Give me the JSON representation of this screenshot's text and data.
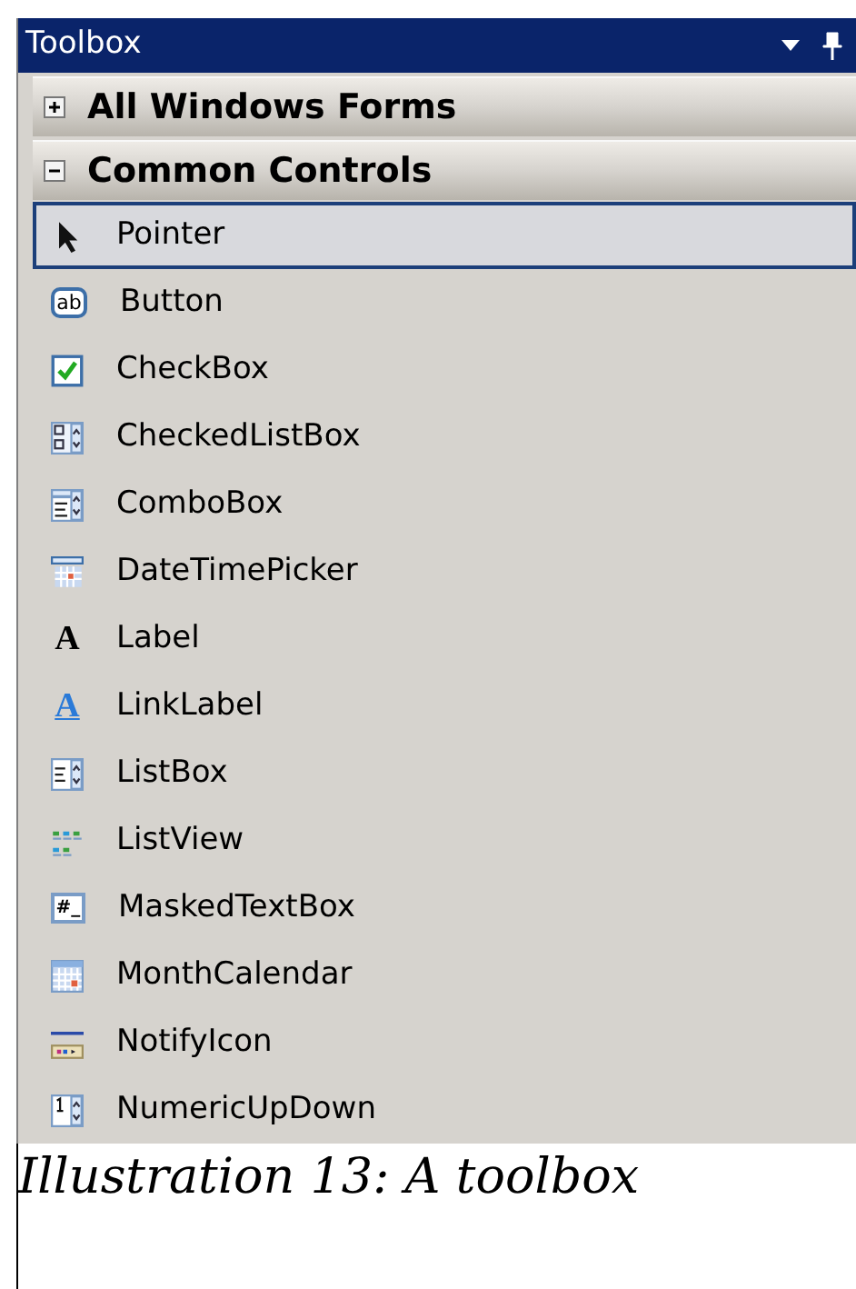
{
  "window": {
    "title": "Toolbox"
  },
  "categories": [
    {
      "label": "All Windows Forms",
      "expanded": false
    },
    {
      "label": "Common Controls",
      "expanded": true
    }
  ],
  "items": [
    {
      "label": "Pointer",
      "kind": "pointer",
      "selected": true
    },
    {
      "label": "Button",
      "kind": "button",
      "icon_text": "ab",
      "selected": false
    },
    {
      "label": "CheckBox",
      "kind": "checkbox",
      "selected": false
    },
    {
      "label": "CheckedListBox",
      "kind": "checkedlistbox",
      "selected": false
    },
    {
      "label": "ComboBox",
      "kind": "combobox",
      "selected": false
    },
    {
      "label": "DateTimePicker",
      "kind": "datetimepicker",
      "selected": false
    },
    {
      "label": "Label",
      "kind": "label",
      "icon_text": "A",
      "selected": false
    },
    {
      "label": "LinkLabel",
      "kind": "linklabel",
      "icon_text": "A",
      "selected": false
    },
    {
      "label": "ListBox",
      "kind": "listbox",
      "selected": false
    },
    {
      "label": "ListView",
      "kind": "listview",
      "selected": false
    },
    {
      "label": "MaskedTextBox",
      "kind": "maskedtextbox",
      "icon_text": "#_",
      "selected": false
    },
    {
      "label": "MonthCalendar",
      "kind": "monthcalendar",
      "selected": false
    },
    {
      "label": "NotifyIcon",
      "kind": "notifyicon",
      "selected": false
    },
    {
      "label": "NumericUpDown",
      "kind": "numericupdown",
      "selected": false
    }
  ],
  "caption": "Illustration 13: A toolbox"
}
